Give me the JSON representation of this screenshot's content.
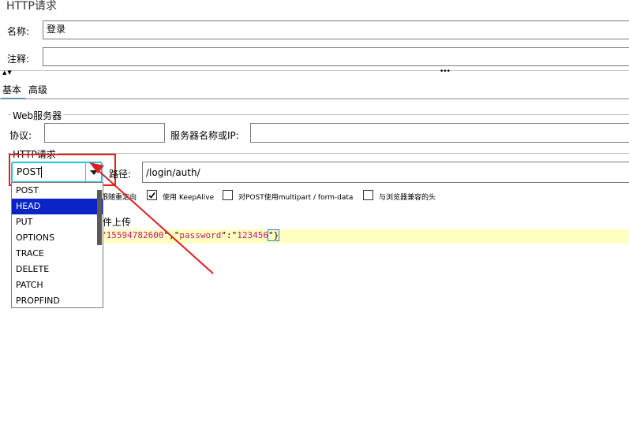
{
  "header": {
    "title": "HTTP请求"
  },
  "name_row": {
    "label": "名称:",
    "value": "登录"
  },
  "comment_row": {
    "label": "注释:",
    "value": ""
  },
  "splitter": {
    "arrows": "▲▼",
    "grip": "•••"
  },
  "tabs": [
    {
      "label": "基本"
    },
    {
      "label": "高级"
    }
  ],
  "web_server": {
    "title": "Web服务器",
    "protocol_label": "协议:",
    "protocol_value": "",
    "server_label": "服务器名称或IP:",
    "server_value": ""
  },
  "http_request": {
    "title": "HTTP请求",
    "method_value": "POST",
    "path_label": "路径:",
    "path_value": "/login/auth/"
  },
  "method_dropdown": {
    "options": [
      "POST",
      "HEAD",
      "PUT",
      "OPTIONS",
      "TRACE",
      "DELETE",
      "PATCH",
      "PROPFIND"
    ],
    "highlighted": "HEAD"
  },
  "options_row": {
    "redirect_label": "跟随重定向",
    "keepalive_label": "使用 KeepAlive",
    "keepalive_checked": true,
    "multipart_label": "对POST使用multipart / form-data",
    "browser_headers_label": "与浏览器兼容的头"
  },
  "body_section": {
    "file_upload_label": "件上传",
    "body_parts": [
      "15594782600",
      "\",\"",
      "password",
      "\":\"",
      "123456",
      "\"}"
    ],
    "prefix_quote": "\""
  },
  "colors": {
    "dropdown_highlight": "#0a24c8",
    "annotation_red": "#e02020",
    "focus_cyan": "#22c4dc",
    "body_bg": "#ffffc0"
  }
}
